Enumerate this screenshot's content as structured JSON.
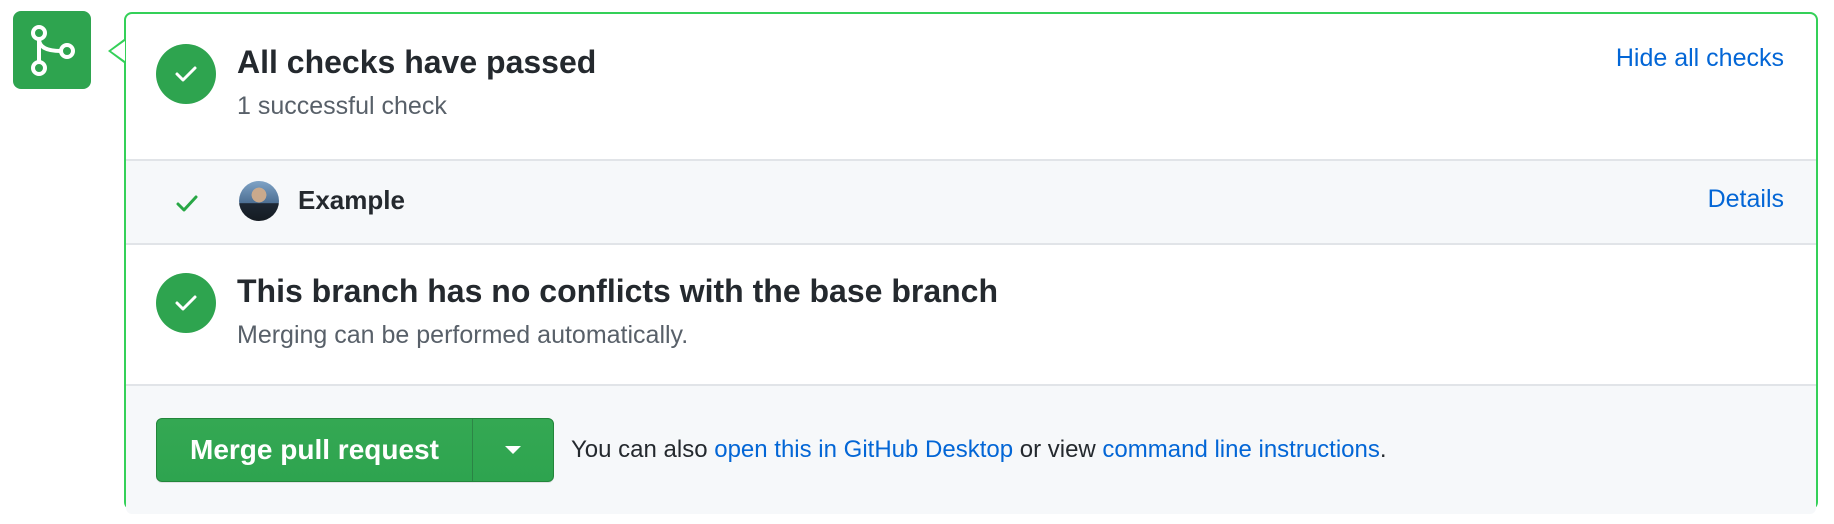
{
  "checks": {
    "title": "All checks have passed",
    "subtitle": "1 successful check",
    "toggle_label": "Hide all checks"
  },
  "check_item": {
    "name": "Example",
    "details_label": "Details"
  },
  "conflicts": {
    "title": "This branch has no conflicts with the base branch",
    "subtitle": "Merging can be performed automatically."
  },
  "merge": {
    "button_label": "Merge pull request",
    "prefix_text": "You can also ",
    "desktop_link": "open this in GitHub Desktop",
    "middle_text": " or view ",
    "cli_link": "command line instructions",
    "suffix_text": "."
  },
  "colors": {
    "success": "#2ea44f",
    "border_success": "#34d058",
    "link": "#0366d6"
  },
  "icons": {
    "badge": "git-merge-icon",
    "status": "check-icon",
    "dropdown": "triangle-down-icon"
  }
}
